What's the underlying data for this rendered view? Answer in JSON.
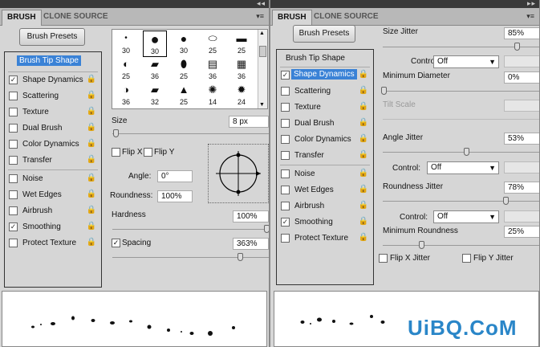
{
  "left": {
    "tabs": [
      "BRUSH",
      "CLONE SOURCE"
    ],
    "brush_presets_label": "Brush Presets",
    "tip_shape_label": "Brush Tip Shape",
    "items": [
      {
        "label": "Shape Dynamics",
        "checked": true
      },
      {
        "label": "Scattering",
        "checked": false
      },
      {
        "label": "Texture",
        "checked": false
      },
      {
        "label": "Dual Brush",
        "checked": false
      },
      {
        "label": "Color Dynamics",
        "checked": false
      },
      {
        "label": "Transfer",
        "checked": false
      },
      {
        "label": "Noise",
        "checked": false
      },
      {
        "label": "Wet Edges",
        "checked": false
      },
      {
        "label": "Airbrush",
        "checked": false
      },
      {
        "label": "Smoothing",
        "checked": true
      },
      {
        "label": "Protect Texture",
        "checked": false
      }
    ],
    "brush_sizes": [
      "30",
      "30",
      "30",
      "25",
      "25",
      "25",
      "36",
      "25",
      "36",
      "36",
      "36",
      "32",
      "25",
      "14",
      "24"
    ],
    "size_label": "Size",
    "size_value": "8 px",
    "flip_x_label": "Flip X",
    "flip_y_label": "Flip Y",
    "angle_label": "Angle:",
    "angle_value": "0°",
    "roundness_label": "Roundness:",
    "roundness_value": "100%",
    "hardness_label": "Hardness",
    "hardness_value": "100%",
    "spacing_label": "Spacing",
    "spacing_value": "363%"
  },
  "right": {
    "tabs": [
      "BRUSH",
      "CLONE SOURCE"
    ],
    "brush_presets_label": "Brush Presets",
    "tip_shape_label": "Brush Tip Shape",
    "selected_label": "Shape Dynamics",
    "items": [
      {
        "label": "Scattering",
        "checked": false
      },
      {
        "label": "Texture",
        "checked": false
      },
      {
        "label": "Dual Brush",
        "checked": false
      },
      {
        "label": "Color Dynamics",
        "checked": false
      },
      {
        "label": "Transfer",
        "checked": false
      },
      {
        "label": "Noise",
        "checked": false
      },
      {
        "label": "Wet Edges",
        "checked": false
      },
      {
        "label": "Airbrush",
        "checked": false
      },
      {
        "label": "Smoothing",
        "checked": true
      },
      {
        "label": "Protect Texture",
        "checked": false
      }
    ],
    "size_jitter_label": "Size Jitter",
    "size_jitter_value": "85%",
    "control_label": "Control:",
    "control1_value": "Off",
    "min_diameter_label": "Minimum Diameter",
    "min_diameter_value": "0%",
    "tilt_scale_label": "Tilt Scale",
    "angle_jitter_label": "Angle Jitter",
    "angle_jitter_value": "53%",
    "control2_value": "Off",
    "roundness_jitter_label": "Roundness Jitter",
    "roundness_jitter_value": "78%",
    "control3_value": "Off",
    "min_roundness_label": "Minimum Roundness",
    "min_roundness_value": "25%",
    "flip_x_jitter_label": "Flip X Jitter",
    "flip_y_jitter_label": "Flip Y Jitter"
  },
  "watermark": "UiBQ.CoM",
  "colors": {
    "selection": "#3a82d6",
    "watermark": "#2a86c8"
  }
}
